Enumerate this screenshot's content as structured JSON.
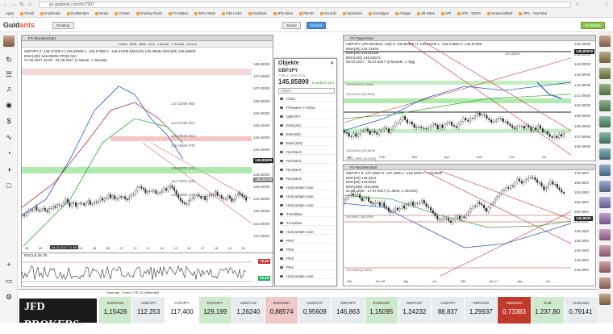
{
  "browser": {
    "url": "go.guidants.com/#c/7937",
    "apps_label": "Apps",
    "bookmarks": [
      "Gmail",
      "Godmode",
      "GoldSeiten",
      "News",
      "Charts",
      "Trading-Tools",
      "FX-Makro",
      "MT4-Stats",
      "GM-Links",
      "Guidants",
      "JFD-Sites",
      "READ",
      "Sounds",
      "Sprachen",
      "Sonstiges",
      "Ablage",
      "JB-Sites",
      "API",
      "JFD - DE3A",
      "SeasonalBull",
      "JFD - YouTube"
    ]
  },
  "app": {
    "logo_main": "Guid",
    "logo_accent": "ants",
    "desktop_label": "Desktop",
    "search_label": "Suche",
    "screen_label": "Screen",
    "close_label": "Schliesen"
  },
  "left_chart": {
    "title": "FX-Stundenchart",
    "legend": [
      "GBPJPY 0: 145,27400 H: 145,32600 L: 145,17600 C: 145,21300 EMA(20) 145,38184 EMA(50) 146,26600",
      "EMA(100) 145,09205 PP(D) N/A",
      "27.06.2017 18:00 - 01.08.2017 (1 Monat, 1 Stunde)"
    ],
    "toolbar": [
      "Linien",
      "EMA",
      "BMA",
      "Inne",
      "1 Monat",
      "1 Stunde",
      "Kerzen"
    ],
    "y_ticks": [
      "148,00000",
      "147,50000",
      "147,00000",
      "146,50000",
      "146,00000",
      "145,50000",
      "145,00000",
      "144,50000",
      "144,00000",
      "143,50000",
      "143,00000",
      "142,50000",
      "142,00000",
      "141,50000",
      "141,00000"
    ],
    "levels": [
      "147,32598 (R3)",
      "147,07298 (R2)",
      "146,29436 (R1)",
      "145,76400 (PP)",
      "145,20201 (S1)",
      "144,70201 (S2)",
      "144,19002 (S3)"
    ],
    "price_tags": {
      "current": "145,85999",
      "low": "145,05109"
    },
    "x_ticks": [
      "28",
      "29",
      "30",
      "03",
      "04",
      "05",
      "06",
      "07",
      "10",
      "11",
      "12",
      "13",
      "14",
      "17",
      "18",
      "19",
      "20"
    ],
    "cursor_date": "04.07.2017 17:00",
    "rsi": {
      "label": "RSI(14) 35,79",
      "upper": "70,00",
      "lower": "30,00"
    }
  },
  "objects_panel": {
    "title": "Objekte",
    "symbol": "GBPJPY",
    "sub": "FOREX / NEW YORK",
    "price": "145,85899",
    "change": "0,1545 0,11%",
    "search_placeholder": "Objekt",
    "items": [
      "Chart",
      "Primaere Y-Achse",
      "GBPJPY",
      "EMA(20)",
      "EMA(50)",
      "EMA(100)",
      "Rechteck",
      "Rechteck",
      "Rechteck",
      "Rechteck",
      "Horizontale Linie",
      "Horizontale Linie",
      "Horizontale Linie",
      "Trendlinie",
      "Trendlinie",
      "Horizontale Linie",
      "Pfeil",
      "Pfeil",
      "Pfeil",
      "Pfeil",
      "Horizontale Linie"
    ]
  },
  "top_right_chart": {
    "title": "FX-Tageschart",
    "legend": [
      "GBPJPY (JFD Brokers, Indi) 0: 145,55300 H: 145,51200 L: 145,21800 C: 145,57000",
      "EMA(20) 144,71004",
      "EMA(50) 144,50199",
      "EMA(100) 145,22574",
      "29.02.2017 - 20.07.2017 (5 Monate, 1 Tag)"
    ],
    "y_ticks": [
      "146,00000",
      "145,00000",
      "144,00000",
      "143,00000",
      "142,00000",
      "141,00000",
      "140,00000",
      "139,00000",
      "138,00000",
      "137,00000",
      "136,00000"
    ],
    "price_tag": "145,90000",
    "labels": [
      "143,30000 (2,00%)",
      "141,31110 (23,60%)",
      "135,43400 (50,00%)",
      "145,48000",
      "135,1,4900 (61,80%)"
    ],
    "x_ticks": [
      "Jan",
      "Feb",
      "Mrz",
      "Apr",
      "Mai",
      "Jun",
      "Jul"
    ]
  },
  "bottom_right_chart": {
    "title": "FX-Wochenchart",
    "legend": [
      "GBPJPY 0: 147,4800 H: 147,3300 L: 145,2000 C: 145,6530",
      "EMA(20) 145,2112",
      "EMA(50) 143,0667",
      "EMA(100) 149,4486",
      "31.08.2015 - 17.07.2017 (2 Jahre, 1 Woche)"
    ],
    "y_ticks": [
      "170,0000",
      "165,0000",
      "160,0000",
      "155,0000",
      "150,0000",
      "145,0000",
      "140,0000",
      "135,0000",
      "130,0000",
      "125,0000",
      "120,0000"
    ],
    "price_tag": "145,8530",
    "labels": [
      "160,9847 (38,20%)",
      "122,3030 (0,00%)"
    ],
    "x_ticks": [
      "Okt",
      "Jan 16",
      "Apr",
      "Jul",
      "Okt",
      "Jan 17",
      "Apr",
      "Jul"
    ]
  },
  "heatmap": {
    "title": "Heatmap - Forex-TOP-15 (Watchlist)",
    "cells": [
      {
        "sym": "EUR/USD",
        "val": "1,15426",
        "color": "#cfe9cd"
      },
      {
        "sym": "USD/JPY",
        "val": "112,253",
        "color": "#e8ecef"
      },
      {
        "sym": "CHF/JPY",
        "val": "117,400",
        "color": "#ffffff"
      },
      {
        "sym": "EUR/JPY",
        "val": "129,199",
        "color": "#cfe9cd"
      },
      {
        "sym": "USD/CAD",
        "val": "1,26240",
        "color": "#e8ecef"
      },
      {
        "sym": "EUR/GBP",
        "val": "0,88574",
        "color": "#f0c8c8"
      },
      {
        "sym": "USD/CHF",
        "val": "0,95609",
        "color": "#e8ecef"
      },
      {
        "sym": "GBP/JPY",
        "val": "145,863",
        "color": "#e8ecef"
      },
      {
        "sym": "EUR/USD",
        "val": "1,15095",
        "color": "#cfe9cd"
      },
      {
        "sym": "GBP/CHF",
        "val": "1,24232",
        "color": "#e8ecef"
      },
      {
        "sym": "AUD/JPY",
        "val": "88,837",
        "color": "#e8ecef"
      },
      {
        "sym": "GBP/USD",
        "val": "1,29937",
        "color": "#e8ecef"
      },
      {
        "sym": "NZD/USD",
        "val": "0,73383",
        "color": "#c0392b"
      },
      {
        "sym": "Gold",
        "val": "1.237,80",
        "color": "#cfe9cd"
      },
      {
        "sym": "AUD/USD",
        "val": "0,79141",
        "color": "#e8ecef"
      }
    ]
  },
  "brand": {
    "name": "JFD BROKERS",
    "tagline": "ALL YOUR ASSET PORTFOLIO"
  }
}
